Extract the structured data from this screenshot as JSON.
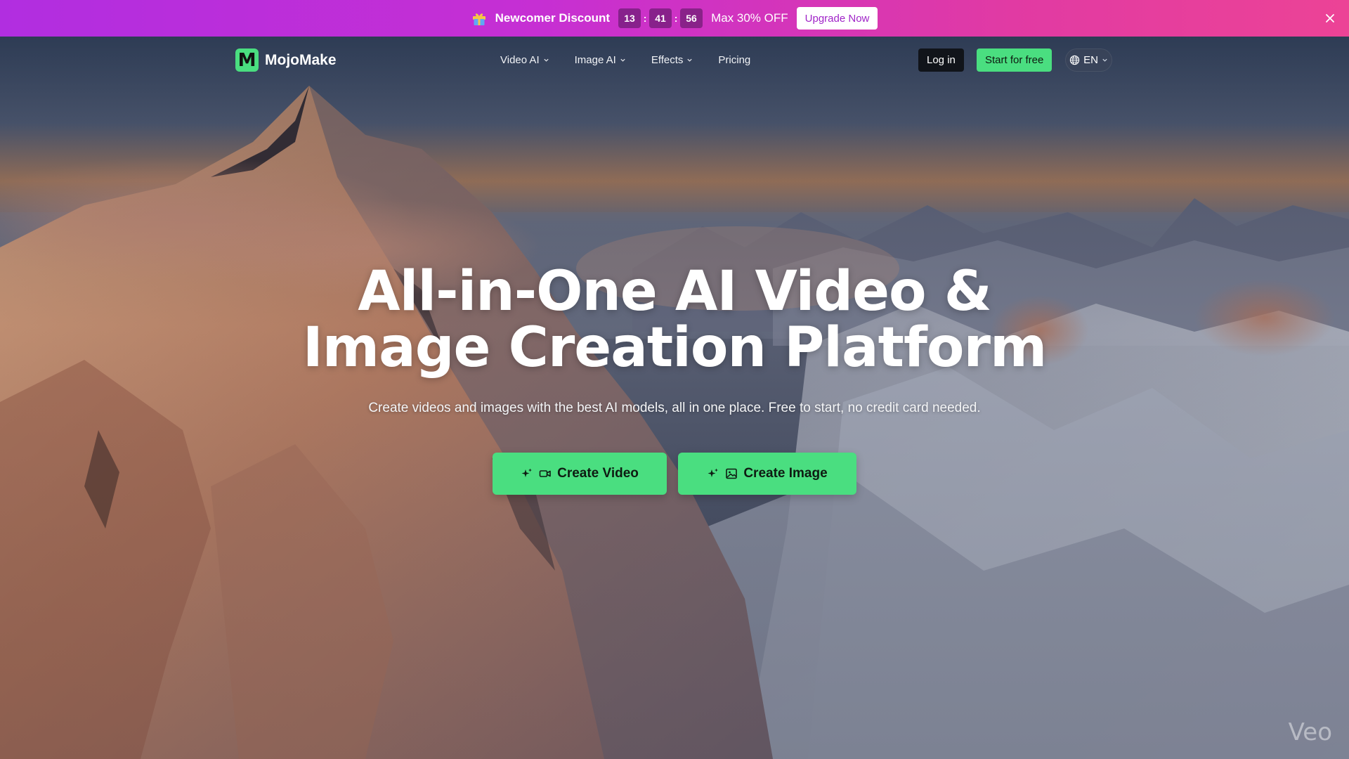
{
  "promo": {
    "title": "Newcomer Discount",
    "countdown": {
      "hours": "13",
      "minutes": "41",
      "seconds": "56",
      "separator": ":"
    },
    "discount": "Max 30% OFF",
    "upgrade_label": "Upgrade Now",
    "icons": {
      "gift": "gift-icon",
      "close": "close-icon"
    },
    "gradient_colors": [
      "#b12ee0",
      "#ec4396"
    ]
  },
  "nav": {
    "brand": {
      "logo_letter": "M",
      "name": "MojoMake"
    },
    "menu": [
      {
        "label": "Video AI",
        "has_dropdown": true
      },
      {
        "label": "Image AI",
        "has_dropdown": true
      },
      {
        "label": "Effects",
        "has_dropdown": true
      },
      {
        "label": "Pricing",
        "has_dropdown": false
      }
    ],
    "login_label": "Log in",
    "start_label": "Start for free",
    "language": {
      "label": "EN",
      "icon": "globe-icon"
    }
  },
  "hero": {
    "headline_line1": "All-in-One AI Video &",
    "headline_line2": "Image Creation Platform",
    "subheadline": "Create videos and images with the best AI models, all in one place. Free to start, no credit card needed.",
    "cta_video_label": "Create Video",
    "cta_image_label": "Create Image",
    "watermark": "Veo"
  },
  "colors": {
    "accent": "#4ade80",
    "login_bg": "#11141a",
    "upgrade_text": "#a024c8"
  }
}
